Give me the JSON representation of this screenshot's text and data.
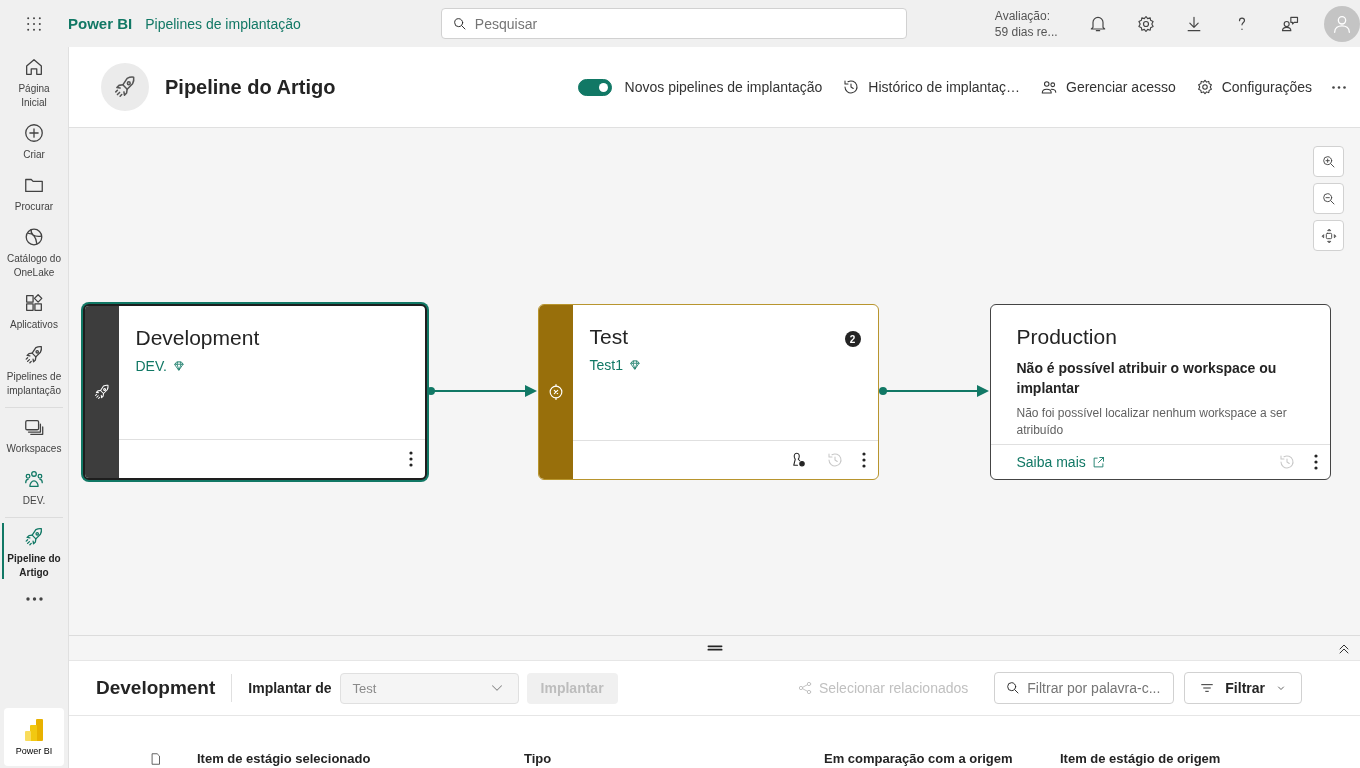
{
  "topbar": {
    "brand": "Power BI",
    "breadcrumb": "Pipelines de implantação",
    "search": {
      "placeholder": "Pesquisar"
    },
    "trial": [
      "Avaliação:",
      "59 dias re..."
    ]
  },
  "sidebar": {
    "items": [
      {
        "label": "Página Inicial",
        "selected": false,
        "separated": false
      },
      {
        "label": "Criar",
        "selected": false,
        "separated": false
      },
      {
        "label": "Procurar",
        "selected": false,
        "separated": false
      },
      {
        "label": "Catálogo do OneLake",
        "selected": false,
        "separated": false
      },
      {
        "label": "Aplicativos",
        "selected": false,
        "separated": false
      },
      {
        "label": "Pipelines de implantação",
        "selected": false,
        "separated": false
      },
      {
        "label": "Workspaces",
        "selected": false,
        "separated": true
      },
      {
        "label": "DEV.",
        "selected": false,
        "separated": false
      },
      {
        "label": "Pipeline do Artigo",
        "selected": true,
        "separated": true
      }
    ],
    "app": "Power BI"
  },
  "header": {
    "title": "Pipeline do Artigo",
    "toggle": {
      "label": "Novos pipelines de implantação",
      "on": true
    },
    "actions": [
      "Histórico de implantaç…",
      "Gerenciar acesso",
      "Configurações"
    ]
  },
  "stages": [
    {
      "kind": "source",
      "title": "Development",
      "workspace": "DEV.",
      "selected": true,
      "color": "#3d3d3d"
    },
    {
      "kind": "target",
      "title": "Test",
      "workspace": "Test1",
      "badge": "2",
      "selected": false,
      "color": "#986f0b"
    },
    {
      "kind": "empty",
      "title": "Production",
      "message": "Não é possível atribuir o workspace ou implantar",
      "description": "Não foi possível localizar nenhum workspace a ser atribuído",
      "link": "Saiba mais",
      "selected": false
    }
  ],
  "panel": {
    "title": "Development",
    "deploy_from_label": "Implantar de",
    "deploy_from": {
      "value": "Test",
      "disabled": true
    },
    "deploy_button": {
      "label": "Implantar",
      "disabled": true
    },
    "select_related": {
      "label": "Selecionar relacionados",
      "disabled": true
    },
    "filter_search": {
      "placeholder": "Filtrar por palavra-c..."
    },
    "filter_button": "Filtrar",
    "columns": [
      "Item de estágio selecionado",
      "Tipo",
      "Em comparação com a origem",
      "Item de estágio de origem"
    ]
  }
}
